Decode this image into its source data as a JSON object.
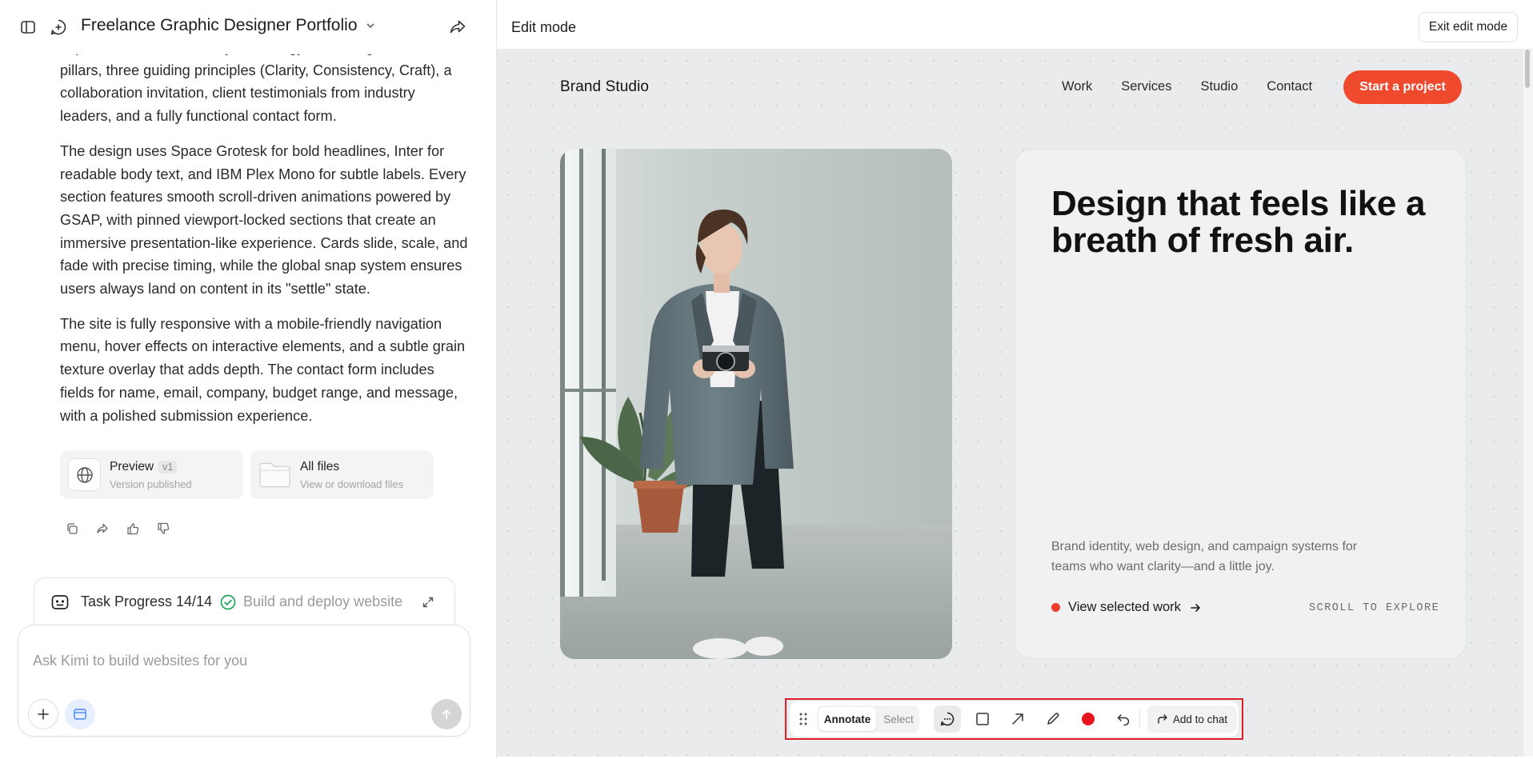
{
  "left": {
    "project_title": "Freelance Graphic Designer Portfolio",
    "message_paragraphs": [
      "explanation with Discovery & Strategy and Design & Build pillars, three guiding principles (Clarity, Consistency, Craft), a collaboration invitation, client testimonials from industry leaders, and a fully functional contact form.",
      "The design uses Space Grotesk for bold headlines, Inter for readable body text, and IBM Plex Mono for subtle labels. Every section features smooth scroll-driven animations powered by GSAP, with pinned viewport-locked sections that create an immersive presentation-like experience. Cards slide, scale, and fade with precise timing, while the global snap system ensures users always land on content in its \"settle\" state.",
      "The site is fully responsive with a mobile-friendly navigation menu, hover effects on interactive elements, and a subtle grain texture overlay that adds depth. The contact form includes fields for name, email, company, budget range, and message, with a polished submission experience."
    ],
    "cards": {
      "preview": {
        "title": "Preview",
        "version": "v1",
        "subtitle": "Version published",
        "icon": "globe-icon"
      },
      "files": {
        "title": "All files",
        "subtitle": "View or download files",
        "icon": "folder-icon"
      }
    },
    "feedback_icons": [
      "copy-icon",
      "share-icon",
      "thumbs-up-icon",
      "thumbs-down-icon"
    ],
    "task": {
      "label": "Task Progress 14/14",
      "status": "Build and deploy website",
      "status_color": "#22a55a"
    },
    "composer": {
      "placeholder": "Ask Kimi to build websites for you"
    }
  },
  "right": {
    "header": {
      "title": "Edit mode",
      "exit_label": "Exit edit mode"
    },
    "site": {
      "brand": "Brand Studio",
      "nav": [
        "Work",
        "Services",
        "Studio",
        "Contact"
      ],
      "cta": "Start a project",
      "accent": "#f04a2e",
      "headline": "Design that feels like a breath of fresh air.",
      "subtext": "Brand identity, web design, and campaign systems for teams who want clarity—and a little joy.",
      "link": "View selected work",
      "scroll_hint": "SCROLL TO EXPLORE"
    },
    "toolbar": {
      "annotate": "Annotate",
      "select": "Select",
      "add_to_chat": "Add to chat",
      "tools": [
        "comment-icon",
        "rectangle-icon",
        "arrow-icon",
        "pencil-icon",
        "color-dot-icon",
        "undo-icon"
      ],
      "active_color": "#e8141b",
      "highlight_color": "#e11d2a"
    }
  }
}
